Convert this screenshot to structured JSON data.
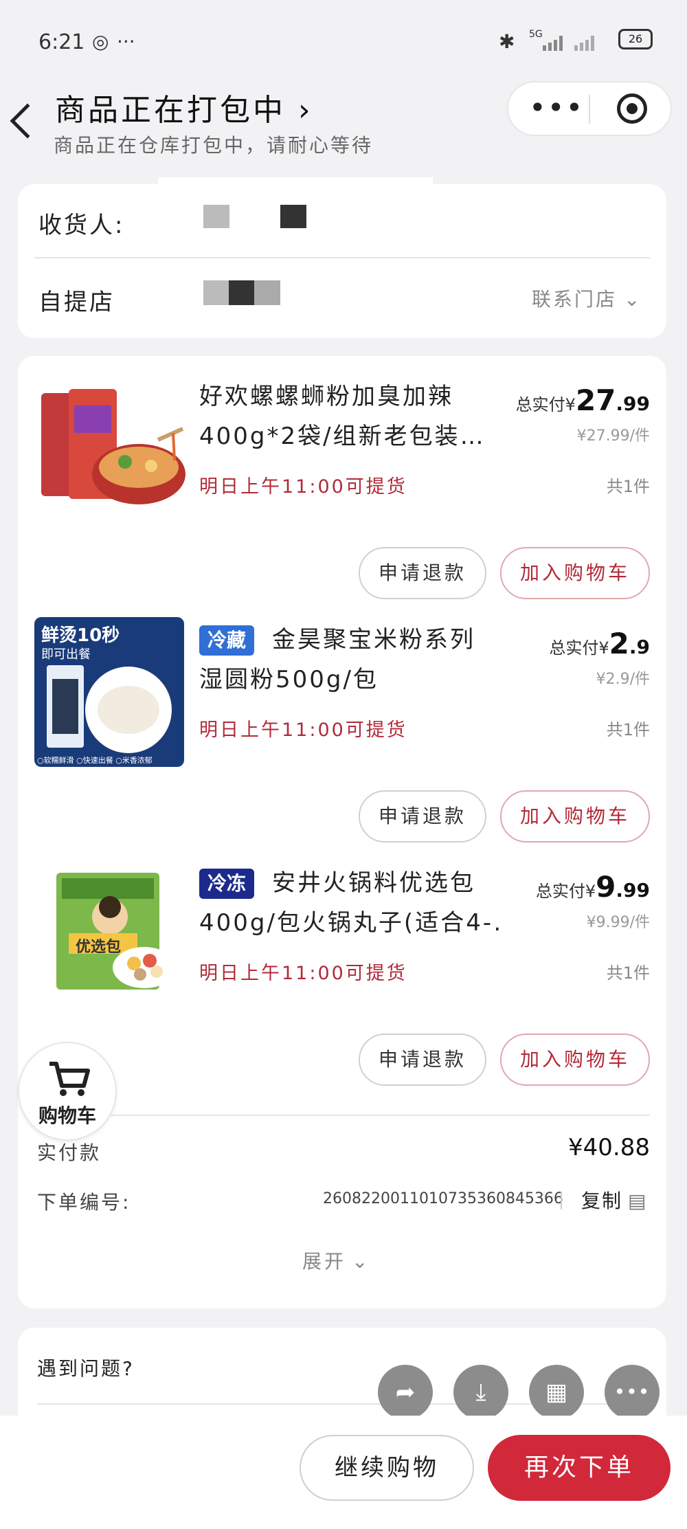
{
  "status": {
    "time": "6:21",
    "network": "5G",
    "battery": "26"
  },
  "header": {
    "title": "商品正在打包中",
    "subtitle": "商品正在仓库打包中，请耐心等待",
    "capsule_menu": "•••"
  },
  "receiver": {
    "label": "收货人:",
    "pickup_label": "自提店",
    "contact_store": "联系门店"
  },
  "products": [
    {
      "title_line1": "好欢螺螺蛳粉加臭加辣",
      "title_line2": "400g*2袋/组新老包装…",
      "tag": "",
      "pickup": "明日上午11:00可提货",
      "price_label": "总实付",
      "currency": "¥",
      "price_int": "27",
      "price_dec": ".99",
      "unit_price": "¥27.99/件",
      "qty": "共1件"
    },
    {
      "title_line1": "金昊聚宝米粉系列",
      "title_line2": "湿圆粉500g/包",
      "tag": "冷藏",
      "pickup": "明日上午11:00可提货",
      "price_label": "总实付",
      "currency": "¥",
      "price_int": "2",
      "price_dec": ".9",
      "unit_price": "¥2.9/件",
      "qty": "共1件",
      "img_text_1": "鲜烫10秒",
      "img_text_2": "即可出餐",
      "img_footer": "○软糯鲜滑  ○快速出餐  ○米香浓郁"
    },
    {
      "title_line1": "安井火锅料优选包",
      "title_line2": "400g/包火锅丸子(适合4-…",
      "tag": "冷冻",
      "pickup": "明日上午11:00可提货",
      "price_label": "总实付",
      "currency": "¥",
      "price_int": "9",
      "price_dec": ".99",
      "unit_price": "¥9.99/件",
      "qty": "共1件",
      "img_text": "优选包"
    }
  ],
  "buttons": {
    "refund": "申请退款",
    "add_cart": "加入购物车"
  },
  "cart_fab": "购物车",
  "summary": {
    "paid_label": "实付款",
    "paid_value": "¥40.88",
    "order_label": "下单编号:",
    "order_no": "2608220011010735360845366",
    "copy": "复制",
    "expand": "展开"
  },
  "help": {
    "label": "遇到问题?"
  },
  "footer": {
    "continue": "继续购物",
    "reorder": "再次下单"
  },
  "colors": {
    "accent_red": "#d1283a",
    "chill_tag": "#2f6fd6",
    "frozen_tag": "#1b2a8c"
  }
}
